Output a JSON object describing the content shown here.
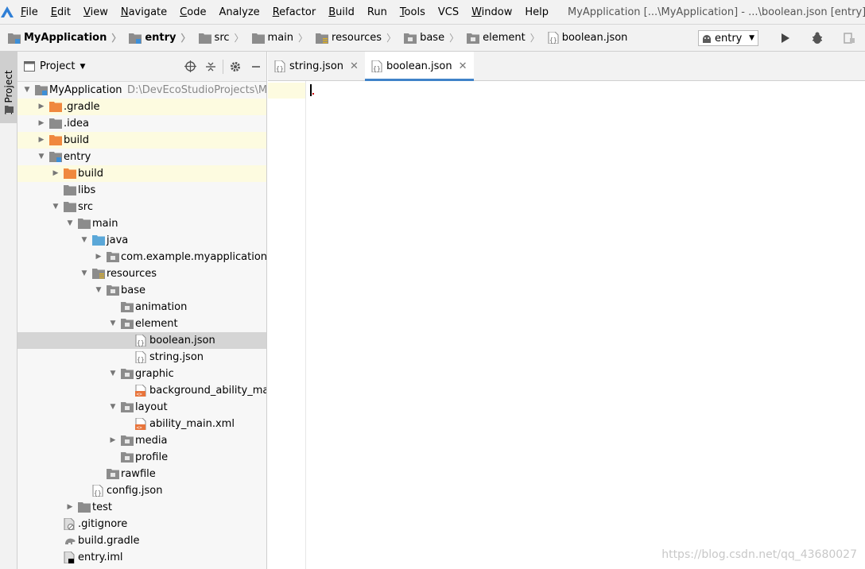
{
  "menubar": {
    "items": [
      {
        "label": "File",
        "mnemonic": "F",
        "rest": "ile"
      },
      {
        "label": "Edit",
        "mnemonic": "E",
        "rest": "dit"
      },
      {
        "label": "View",
        "mnemonic": "V",
        "rest": "iew"
      },
      {
        "label": "Navigate",
        "mnemonic": "N",
        "rest": "avigate"
      },
      {
        "label": "Code",
        "mnemonic": "C",
        "rest": "ode"
      },
      {
        "label": "Analyze",
        "mnemonic": "",
        "rest": "Analyze"
      },
      {
        "label": "Refactor",
        "mnemonic": "R",
        "rest": "efactor"
      },
      {
        "label": "Build",
        "mnemonic": "B",
        "rest": "uild"
      },
      {
        "label": "Run",
        "mnemonic": "",
        "rest": "Run"
      },
      {
        "label": "Tools",
        "mnemonic": "T",
        "rest": "ools"
      },
      {
        "label": "VCS",
        "mnemonic": "",
        "rest": "VCS"
      },
      {
        "label": "Window",
        "mnemonic": "W",
        "rest": "indow"
      },
      {
        "label": "Help",
        "mnemonic": "",
        "rest": "Help"
      }
    ],
    "window_title": "MyApplication [...\\MyApplication] - ...\\boolean.json [entry]"
  },
  "breadcrumb": [
    {
      "label": "MyApplication",
      "icon": "module-icon",
      "bold": true
    },
    {
      "label": "entry",
      "icon": "module-icon",
      "bold": true
    },
    {
      "label": "src",
      "icon": "folder-icon"
    },
    {
      "label": "main",
      "icon": "folder-icon"
    },
    {
      "label": "resources",
      "icon": "resources-folder-icon"
    },
    {
      "label": "base",
      "icon": "folder-icon"
    },
    {
      "label": "element",
      "icon": "folder-icon"
    },
    {
      "label": "boolean.json",
      "icon": "json-file-icon"
    }
  ],
  "run_config": {
    "label": "entry"
  },
  "left_strip": {
    "tab_label": "1: Project"
  },
  "project_panel": {
    "title": "Project",
    "tree": [
      {
        "label": "MyApplication",
        "level": 0,
        "arrow": "down",
        "icon": "module",
        "path": "D:\\DevEcoStudioProjects\\MyApp"
      },
      {
        "label": ".gradle",
        "level": 1,
        "arrow": "right",
        "icon": "folder-orange",
        "highlight": true
      },
      {
        "label": ".idea",
        "level": 1,
        "arrow": "right",
        "icon": "folder-grey"
      },
      {
        "label": "build",
        "level": 1,
        "arrow": "right",
        "icon": "folder-orange",
        "highlight": true
      },
      {
        "label": "entry",
        "level": 1,
        "arrow": "down",
        "icon": "module"
      },
      {
        "label": "build",
        "level": 2,
        "arrow": "right",
        "icon": "folder-orange",
        "highlight": true
      },
      {
        "label": "libs",
        "level": 2,
        "arrow": "",
        "icon": "folder-grey"
      },
      {
        "label": "src",
        "level": 2,
        "arrow": "down",
        "icon": "folder-grey"
      },
      {
        "label": "main",
        "level": 3,
        "arrow": "down",
        "icon": "folder-grey"
      },
      {
        "label": "java",
        "level": 4,
        "arrow": "down",
        "icon": "folder-blue"
      },
      {
        "label": "com.example.myapplication",
        "level": 5,
        "arrow": "right",
        "icon": "package"
      },
      {
        "label": "resources",
        "level": 4,
        "arrow": "down",
        "icon": "folder-resources"
      },
      {
        "label": "base",
        "level": 5,
        "arrow": "down",
        "icon": "package"
      },
      {
        "label": "animation",
        "level": 6,
        "arrow": "",
        "icon": "package"
      },
      {
        "label": "element",
        "level": 6,
        "arrow": "down",
        "icon": "package"
      },
      {
        "label": "boolean.json",
        "level": 7,
        "arrow": "",
        "icon": "json",
        "selected": true
      },
      {
        "label": "string.json",
        "level": 7,
        "arrow": "",
        "icon": "json"
      },
      {
        "label": "graphic",
        "level": 6,
        "arrow": "down",
        "icon": "package"
      },
      {
        "label": "background_ability_main.xml",
        "level": 7,
        "arrow": "",
        "icon": "xml"
      },
      {
        "label": "layout",
        "level": 6,
        "arrow": "down",
        "icon": "package"
      },
      {
        "label": "ability_main.xml",
        "level": 7,
        "arrow": "",
        "icon": "xml"
      },
      {
        "label": "media",
        "level": 6,
        "arrow": "right",
        "icon": "package"
      },
      {
        "label": "profile",
        "level": 6,
        "arrow": "",
        "icon": "package"
      },
      {
        "label": "rawfile",
        "level": 5,
        "arrow": "",
        "icon": "package"
      },
      {
        "label": "config.json",
        "level": 4,
        "arrow": "",
        "icon": "json"
      },
      {
        "label": "test",
        "level": 3,
        "arrow": "right",
        "icon": "folder-grey"
      },
      {
        "label": ".gitignore",
        "level": 2,
        "arrow": "",
        "icon": "gitignore"
      },
      {
        "label": "build.gradle",
        "level": 2,
        "arrow": "",
        "icon": "gradle"
      },
      {
        "label": "entry.iml",
        "level": 2,
        "arrow": "",
        "icon": "iml"
      }
    ]
  },
  "editor_tabs": [
    {
      "label": "string.json",
      "active": false
    },
    {
      "label": "boolean.json",
      "active": true
    }
  ],
  "editor": {
    "content": ""
  },
  "watermark": "https://blog.csdn.net/qq_43680027",
  "colors": {
    "accent": "#4083c9",
    "selection": "#d5d5d5",
    "highlight": "#fdfbe0",
    "folder_orange": "#f0883e",
    "folder_blue": "#5aa7d8"
  }
}
